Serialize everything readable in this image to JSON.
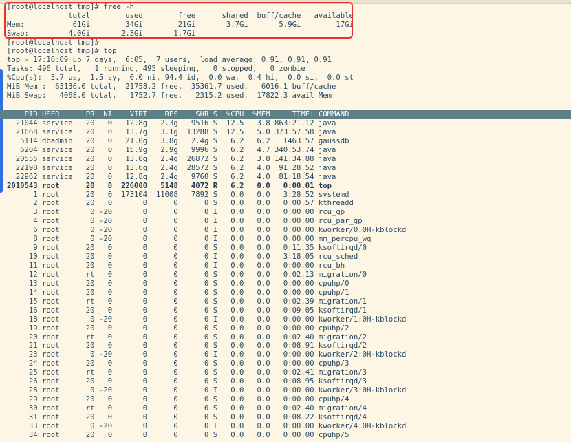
{
  "free_cmd": {
    "prompt_line": "[root@localhost tmp]# free -h",
    "header": "              total        used        free      shared  buff/cache   available",
    "mem": "Mem:           61Gi        34Gi        21Gi       3.7Gi       5.9Gi        17Gi",
    "swap": "Swap:         4.0Gi       2.3Gi       1.7Gi"
  },
  "prompts": [
    "[root@localhost tmp]#",
    "[root@localhost tmp]# top"
  ],
  "top_summary": [
    "top - 17:16:09 up 7 days,  6:05,  7 users,  load average: 0.91, 0.91, 0.91",
    "Tasks: 496 total,   1 running, 495 sleeping,   0 stopped,   0 zombie",
    "%Cpu(s):  3.7 us,  1.5 sy,  0.0 ni, 94.4 id,  0.0 wa,  0.4 hi,  0.0 si,  0.0 st",
    "MiB Mem :  63136.0 total,  21758.2 free,  35361.7 used,   6016.1 buff/cache",
    "MiB Swap:   4068.0 total,   1752.7 free,   2315.2 used.  17822.3 avail Mem"
  ],
  "table_header": "    PID USER      PR  NI    VIRT    RES    SHR S  %CPU  %MEM     TIME+ COMMAND",
  "processes": [
    "  21044 service   20   0   12.8g   2.3g   9516 S  12.5   3.8 863:21.12 java",
    "  21668 service   20   0   13.7g   3.1g  13288 S  12.5   5.0 373:57.58 java",
    "   5114 dbadmin   20   0   21.0g   3.8g   2.4g S   6.2   6.2   1463:57 gaussdb",
    "   6204 service   20   0   15.9g   2.9g   9996 S   6.2   4.7 340:53.74 java",
    "  20555 service   20   0   13.0g   2.4g  26872 S   6.2   3.8 141:34.88 java",
    "  22198 service   20   0   13.6g   2.4g  28572 S   6.2   4.0  91:28.52 java",
    "  22962 service   20   0   12.8g   2.4g   9760 S   6.2   4.0  81:18.54 java",
    "2010543 root      20   0  226000   5148   4072 R   6.2   0.0   0:00.01 top",
    "      1 root      20   0  173104  11008   7892 S   0.0   0.0   3:28.52 systemd",
    "      2 root      20   0       0      0      0 S   0.0   0.0   0:00.57 kthreadd",
    "      3 root       0 -20       0      0      0 I   0.0   0.0   0:00.00 rcu_gp",
    "      4 root       0 -20       0      0      0 I   0.0   0.0   0:00.00 rcu_par_gp",
    "      6 root       0 -20       0      0      0 I   0.0   0.0   0:00.00 kworker/0:0H-kblockd",
    "      8 root       0 -20       0      0      0 I   0.0   0.0   0:00.00 mm_percpu_wq",
    "      9 root      20   0       0      0      0 S   0.0   0.0   0:11.35 ksoftirqd/0",
    "     10 root      20   0       0      0      0 I   0.0   0.0   3:18.05 rcu_sched",
    "     11 root      20   0       0      0      0 I   0.0   0.0   0:00.00 rcu_bh",
    "     12 root      rt   0       0      0      0 S   0.0   0.0   0:02.13 migration/0",
    "     13 root      20   0       0      0      0 S   0.0   0.0   0:00.00 cpuhp/0",
    "     14 root      20   0       0      0      0 S   0.0   0.0   0:00.00 cpuhp/1",
    "     15 root      rt   0       0      0      0 S   0.0   0.0   0:02.39 migration/1",
    "     16 root      20   0       0      0      0 S   0.0   0.0   0:09.05 ksoftirqd/1",
    "     18 root       0 -20       0      0      0 I   0.0   0.0   0:00.00 kworker/1:0H-kblockd",
    "     19 root      20   0       0      0      0 S   0.0   0.0   0:00.00 cpuhp/2",
    "     20 root      rt   0       0      0      0 S   0.0   0.0   0:02.40 migration/2",
    "     21 root      20   0       0      0      0 S   0.0   0.0   0:08.91 ksoftirqd/2",
    "     23 root       0 -20       0      0      0 I   0.0   0.0   0:00.00 kworker/2:0H-kblockd",
    "     24 root      20   0       0      0      0 S   0.0   0.0   0:00.00 cpuhp/3",
    "     25 root      rt   0       0      0      0 S   0.0   0.0   0:02.41 migration/3",
    "     26 root      20   0       0      0      0 S   0.0   0.0   0:08.95 ksoftirqd/3",
    "     28 root       0 -20       0      0      0 I   0.0   0.0   0:00.00 kworker/3:0H-kblockd",
    "     29 root      20   0       0      0      0 S   0.0   0.0   0:00.00 cpuhp/4",
    "     30 root      rt   0       0      0      0 S   0.0   0.0   0:02.40 migration/4",
    "     31 root      20   0       0      0      0 S   0.0   0.0   0:08.22 ksoftirqd/4",
    "     33 root       0 -20       0      0      0 I   0.0   0.0   0:00.00 kworker/4:0H-kblockd",
    "     34 root      20   0       0      0      0 S   0.0   0.0   0:00.00 cpuhp/5"
  ],
  "highlighted_process_index": 7,
  "colors": {
    "terminal_bg": "#fdf6e4",
    "text": "#2b4a63",
    "header_band": "#5d8088",
    "highlight_border": "#e8322f"
  }
}
